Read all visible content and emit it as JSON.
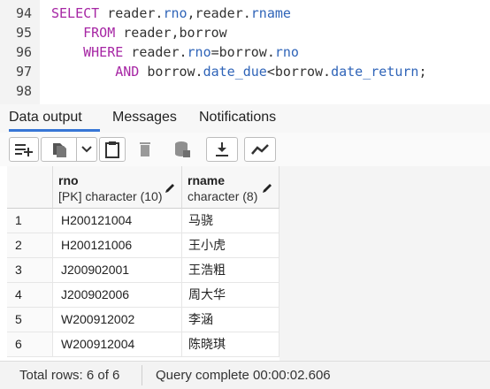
{
  "editor": {
    "lines": [
      {
        "num": "94",
        "parts": [
          {
            "t": "SELECT",
            "c": "kw"
          },
          {
            "t": " reader.",
            "c": ""
          },
          {
            "t": "rno",
            "c": "fld"
          },
          {
            "t": ",reader.",
            "c": ""
          },
          {
            "t": "rname",
            "c": "fld"
          }
        ]
      },
      {
        "num": "95",
        "parts": [
          {
            "t": "    ",
            "c": ""
          },
          {
            "t": "FROM",
            "c": "kw"
          },
          {
            "t": " reader,borrow",
            "c": ""
          }
        ]
      },
      {
        "num": "96",
        "parts": [
          {
            "t": "    ",
            "c": ""
          },
          {
            "t": "WHERE",
            "c": "kw"
          },
          {
            "t": " reader.",
            "c": ""
          },
          {
            "t": "rno",
            "c": "fld"
          },
          {
            "t": "=borrow.",
            "c": ""
          },
          {
            "t": "rno",
            "c": "fld"
          }
        ]
      },
      {
        "num": "97",
        "parts": [
          {
            "t": "        ",
            "c": ""
          },
          {
            "t": "AND",
            "c": "kw"
          },
          {
            "t": " borrow.",
            "c": ""
          },
          {
            "t": "date_due",
            "c": "fld"
          },
          {
            "t": "<borrow.",
            "c": ""
          },
          {
            "t": "date_return",
            "c": "fld"
          },
          {
            "t": ";",
            "c": ""
          }
        ]
      },
      {
        "num": "98",
        "parts": []
      }
    ]
  },
  "tabs": [
    {
      "label": "Data output",
      "active": true
    },
    {
      "label": "Messages",
      "active": false
    },
    {
      "label": "Notifications",
      "active": false
    }
  ],
  "toolbar": {
    "icons": [
      "add-row-icon",
      "copy-icon",
      "chevron-down-icon",
      "paste-icon",
      "delete-icon",
      "save-data-icon",
      "download-icon",
      "graph-icon"
    ]
  },
  "grid": {
    "columns": [
      {
        "name": "rno",
        "type": "[PK] character (10)"
      },
      {
        "name": "rname",
        "type": "character (8)"
      }
    ],
    "rows": [
      {
        "n": "1",
        "rno": "H200121004",
        "rname": "马骁"
      },
      {
        "n": "2",
        "rno": "H200121006",
        "rname": "王小虎"
      },
      {
        "n": "3",
        "rno": "J200902001",
        "rname": "王浩粗"
      },
      {
        "n": "4",
        "rno": "J200902006",
        "rname": "周大华"
      },
      {
        "n": "5",
        "rno": "W200912002",
        "rname": "李涵"
      },
      {
        "n": "6",
        "rno": "W200912004",
        "rname": "陈晓琪"
      }
    ]
  },
  "status": {
    "total_rows": "Total rows: 6 of 6",
    "query": "Query complete 00:00:02.606"
  },
  "colors": {
    "keyword": "#a626a4",
    "field": "#2f64b8",
    "tab_underline": "#3776d6"
  }
}
